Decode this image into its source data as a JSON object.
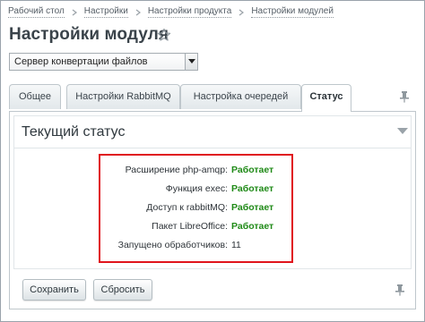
{
  "breadcrumb": [
    {
      "label": "Рабочий стол"
    },
    {
      "label": "Настройки"
    },
    {
      "label": "Настройки продукта"
    },
    {
      "label": "Настройки модулей"
    }
  ],
  "page": {
    "title": "Настройки модуля",
    "favorite_icon": "star-outline-icon"
  },
  "module_select": {
    "value": "Сервер конвертации файлов"
  },
  "tabs": [
    {
      "label": "Общее",
      "active": false
    },
    {
      "label": "Настройки RabbitMQ",
      "active": false
    },
    {
      "label": "Настройка очередей",
      "active": false
    },
    {
      "label": "Статус",
      "active": true
    }
  ],
  "section": {
    "title": "Текущий статус",
    "collapse_icon": "triangle-down-icon"
  },
  "status_rows": [
    {
      "label": "Расширение php-amqp:",
      "value": "Работает"
    },
    {
      "label": "Функция exec:",
      "value": "Работает"
    },
    {
      "label": "Доступ к rabbitMQ:",
      "value": "Работает"
    },
    {
      "label": "Пакет LibreOffice:",
      "value": "Работает"
    },
    {
      "label": "Запущено обработчиков:",
      "value": "11"
    }
  ],
  "buttons": {
    "save": "Сохранить",
    "reset": "Сбросить"
  },
  "colors": {
    "status_ok": "#1f8a17",
    "highlight_border": "#e0141c"
  }
}
